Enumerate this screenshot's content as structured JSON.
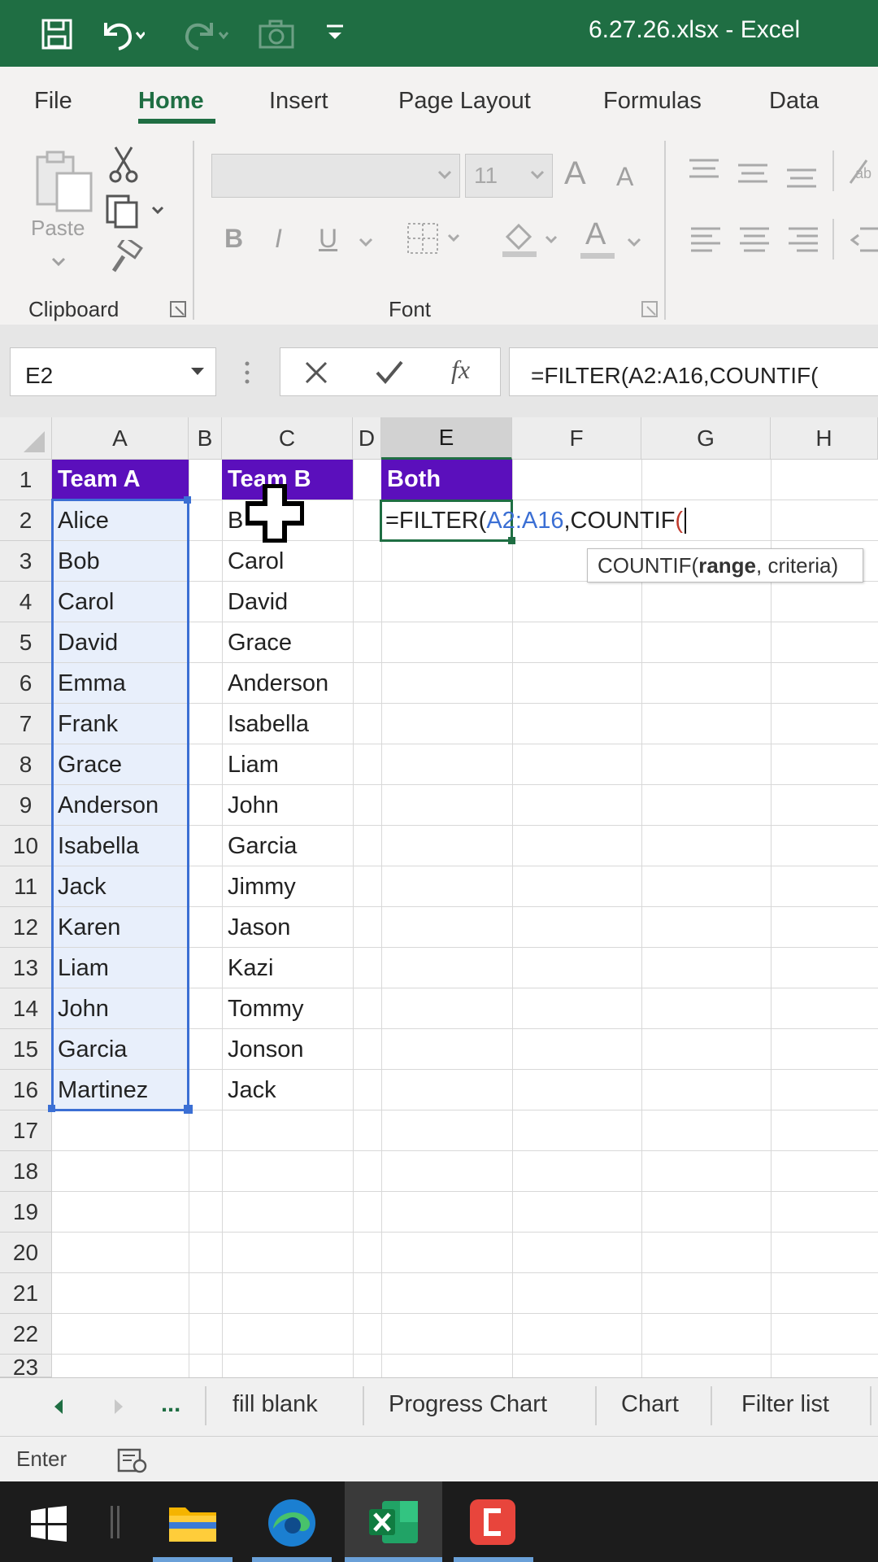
{
  "window": {
    "title": "6.27.26.xlsx  -  Excel"
  },
  "ribbon_tabs": [
    "File",
    "Home",
    "Insert",
    "Page Layout",
    "Formulas",
    "Data"
  ],
  "active_tab": "Home",
  "ribbon": {
    "paste_label": "Paste",
    "clipboard_group": "Clipboard",
    "font_group": "Font",
    "font_size": "11",
    "bold": "B",
    "italic": "I",
    "underline": "U",
    "grow_font": "A",
    "shrink_font": "A",
    "font_color": "A"
  },
  "formula_bar": {
    "name_box": "E2",
    "fx": "fx",
    "formula": "=FILTER(A2:A16,COUNTIF("
  },
  "grid": {
    "columns": [
      "A",
      "B",
      "C",
      "D",
      "E",
      "F",
      "G",
      "H"
    ],
    "rows": [
      "1",
      "2",
      "3",
      "4",
      "5",
      "6",
      "7",
      "8",
      "9",
      "10",
      "11",
      "12",
      "13",
      "14",
      "15",
      "16",
      "17",
      "18",
      "19",
      "20",
      "21",
      "22",
      "23"
    ],
    "selected_column": "E",
    "headers": {
      "a1": "Team A",
      "c1": "Team B",
      "e1": "Both"
    },
    "team_a": [
      "Alice",
      "Bob",
      "Carol",
      "David",
      "Emma",
      "Frank",
      "Grace",
      "Anderson",
      "Isabella",
      "Jack",
      "Karen",
      "Liam",
      "John",
      "Garcia",
      "Martinez"
    ],
    "team_b": [
      "B",
      "Carol",
      "David",
      "Grace",
      "Anderson",
      "Isabella",
      "Liam",
      "John",
      "Garcia",
      "Jimmy",
      "Jason",
      "Kazi",
      "Tommy",
      "Jonson",
      "Jack"
    ],
    "edit_cell": {
      "prefix": "=FILTER(",
      "ref": "A2:A16",
      "suffix": ",COUNTIF",
      "paren": "("
    },
    "tooltip": {
      "func": "COUNTIF(",
      "arg_bold": "range",
      "rest": ", criteria)"
    }
  },
  "sheet_tabs": [
    "fill blank",
    "Progress Chart",
    "Chart",
    "Filter list"
  ],
  "sheet_nav_more": "...",
  "status": {
    "mode": "Enter"
  },
  "colors": {
    "title_bar": "#1f6e43",
    "header_fill": "#5b0fbc",
    "ref_blue": "#3b6fd4",
    "selection_fill": "#e8effb"
  }
}
